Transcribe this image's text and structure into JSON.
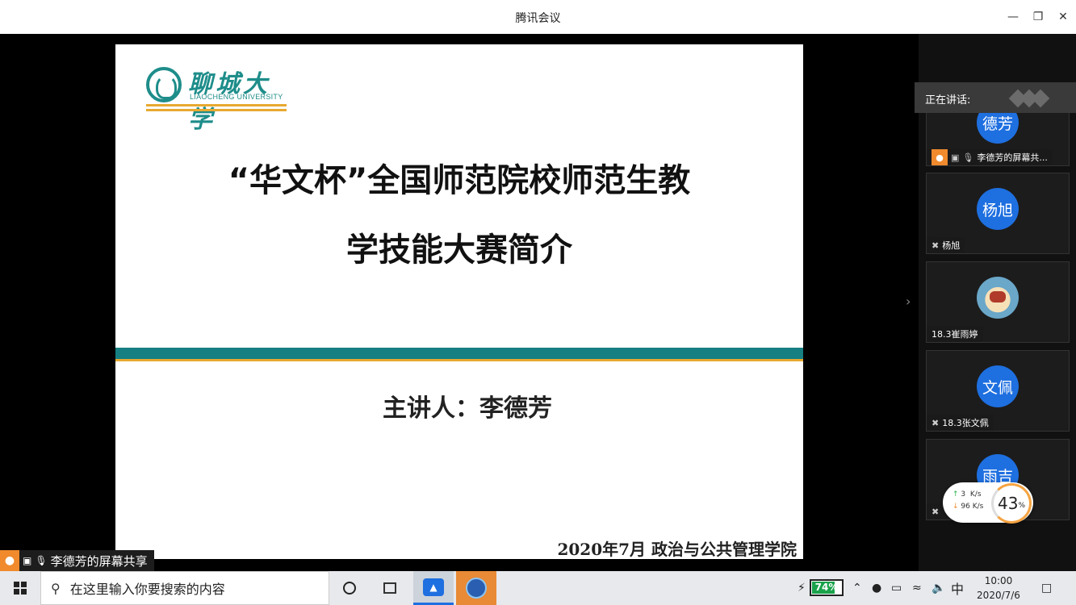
{
  "window": {
    "title": "腾讯会议"
  },
  "slide": {
    "logo_cn": "聊城大学",
    "logo_en": "LIAOCHENG UNIVERSITY",
    "title_line1": "“华文杯”全国师范院校师范生教",
    "title_line2": "学技能大赛简介",
    "presenter": "主讲人：李德芳",
    "footer": "2020年7月  政治与公共管理学院"
  },
  "share_label": "李德芳的屏幕共享",
  "sidebar": {
    "speaking_label": "正在讲话:",
    "participants": [
      {
        "avatar_text": "德芳",
        "name": "李德芳的屏幕共..."
      },
      {
        "avatar_text": "杨旭",
        "name": "杨旭"
      },
      {
        "avatar_text": "",
        "name": "18.3崔雨婷"
      },
      {
        "avatar_text": "文佩",
        "name": "18.3张文佩"
      },
      {
        "avatar_text": "雨吉",
        "name": ""
      }
    ]
  },
  "network": {
    "up": "3",
    "down": "96",
    "unit": "K/s",
    "percent": "43",
    "percent_unit": "%"
  },
  "taskbar": {
    "search_placeholder": "在这里输入你要搜索的内容",
    "battery": "74%",
    "ime": "中",
    "time": "10:00",
    "date": "2020/7/6"
  },
  "icons": {
    "minimize": "minimize-icon",
    "maximize": "restore-icon",
    "close": "close-icon",
    "search": "search-icon",
    "start": "windows-start-icon"
  },
  "colors": {
    "teal": "#157f82",
    "gold": "#e8a930",
    "avatar_blue": "#1e6fe0",
    "share_orange": "#f08a2c"
  }
}
